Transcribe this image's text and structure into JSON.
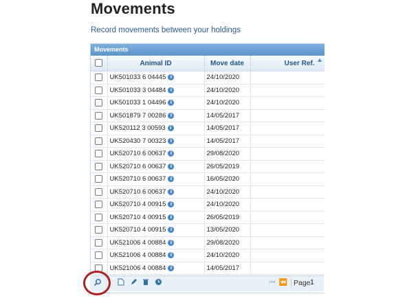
{
  "page": {
    "title": "Movements",
    "subtitle": "Record movements between your holdings"
  },
  "grid": {
    "caption": "Movements",
    "columns": [
      "Animal ID",
      "Move date",
      "User Ref."
    ],
    "rows": [
      {
        "animal_id": "UK501033 6 04445",
        "move_date": "24/10/2020",
        "user_ref": ""
      },
      {
        "animal_id": "UK501033 3 04484",
        "move_date": "24/10/2020",
        "user_ref": ""
      },
      {
        "animal_id": "UK501033 1 04496",
        "move_date": "24/10/2020",
        "user_ref": ""
      },
      {
        "animal_id": "UK501879 7 00286",
        "move_date": "14/05/2017",
        "user_ref": ""
      },
      {
        "animal_id": "UK520112 3 00593",
        "move_date": "14/05/2017",
        "user_ref": ""
      },
      {
        "animal_id": "UK520430 7 00323",
        "move_date": "14/05/2017",
        "user_ref": ""
      },
      {
        "animal_id": "UK520710 6 00637",
        "move_date": "29/08/2020",
        "user_ref": ""
      },
      {
        "animal_id": "UK520710 6 00637",
        "move_date": "26/05/2019",
        "user_ref": ""
      },
      {
        "animal_id": "UK520710 6 00637",
        "move_date": "16/05/2020",
        "user_ref": ""
      },
      {
        "animal_id": "UK520710 6 00637",
        "move_date": "24/10/2020",
        "user_ref": ""
      },
      {
        "animal_id": "UK520710 4 00915",
        "move_date": "24/10/2020",
        "user_ref": ""
      },
      {
        "animal_id": "UK520710 4 00915",
        "move_date": "26/05/2019",
        "user_ref": ""
      },
      {
        "animal_id": "UK520710 4 00915",
        "move_date": "13/05/2020",
        "user_ref": ""
      },
      {
        "animal_id": "UK521006 4 00884",
        "move_date": "29/08/2020",
        "user_ref": ""
      },
      {
        "animal_id": "UK521006 4 00884",
        "move_date": "24/10/2020",
        "user_ref": ""
      },
      {
        "animal_id": "UK521006 4 00884",
        "move_date": "14/05/2017",
        "user_ref": ""
      }
    ]
  },
  "pager": {
    "page_label": "Page",
    "page_value": "1",
    "icons": [
      "search-icon",
      "add-icon",
      "edit-icon",
      "delete-icon",
      "refresh-icon",
      "first-page-icon",
      "prev-page-icon"
    ]
  },
  "colors": {
    "accent": "#5a93cb",
    "header_text": "#1f5688",
    "annotation_circle": "#b21e1e"
  }
}
